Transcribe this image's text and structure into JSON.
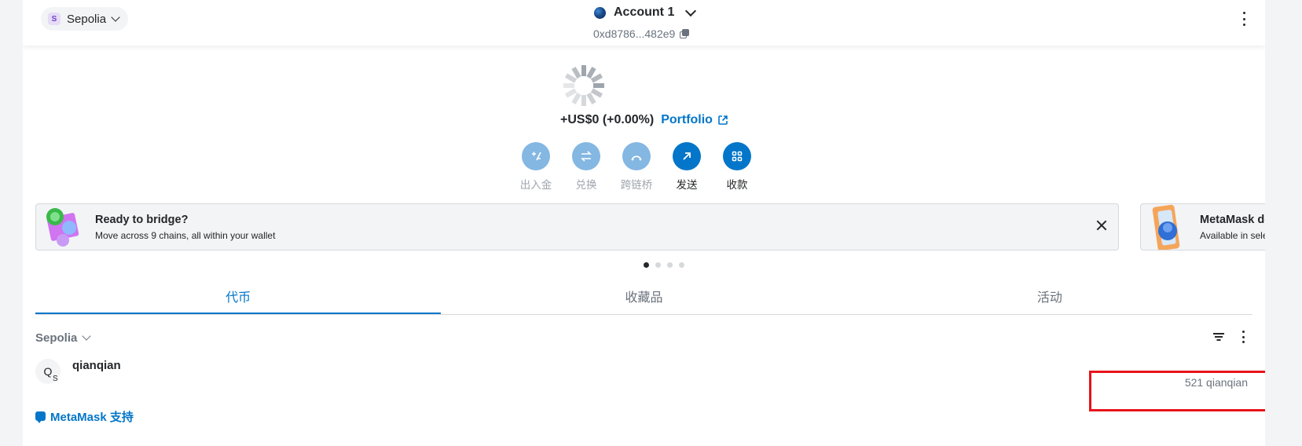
{
  "header": {
    "network": {
      "badge": "S",
      "label": "Sepolia"
    },
    "account": {
      "name": "Account 1",
      "address": "0xd8786...482e9"
    }
  },
  "balance": {
    "change": "+US$0 (+0.00%)",
    "portfolio_label": "Portfolio"
  },
  "actions": [
    {
      "label": "出入金",
      "icon": "buy-sell-icon",
      "enabled": false
    },
    {
      "label": "兑换",
      "icon": "swap-icon",
      "enabled": false
    },
    {
      "label": "跨链桥",
      "icon": "bridge-icon",
      "enabled": false
    },
    {
      "label": "发送",
      "icon": "send-icon",
      "enabled": true
    },
    {
      "label": "收款",
      "icon": "receive-icon",
      "enabled": true
    }
  ],
  "banners": [
    {
      "title": "Ready to bridge?",
      "description": "Move across 9 chains, all within your wallet"
    },
    {
      "title": "MetaMask debit card",
      "description": "Available in select regions"
    }
  ],
  "carousel": {
    "count": 4,
    "active_index": 0
  },
  "tabs": [
    {
      "label": "代币",
      "active": true
    },
    {
      "label": "收藏品",
      "active": false
    },
    {
      "label": "活动",
      "active": false
    }
  ],
  "token_list": {
    "network_filter": "Sepolia",
    "tokens": [
      {
        "avatar_letter": "Q",
        "network_letter": "S",
        "name": "qianqian",
        "balance": "521 qianqian"
      }
    ]
  },
  "support": {
    "label": "MetaMask 支持"
  },
  "colors": {
    "accent": "#0376c9",
    "accent_disabled": "#84b7e2",
    "highlight": "#e8131a",
    "text": "#24272a",
    "muted": "#6a737d"
  }
}
